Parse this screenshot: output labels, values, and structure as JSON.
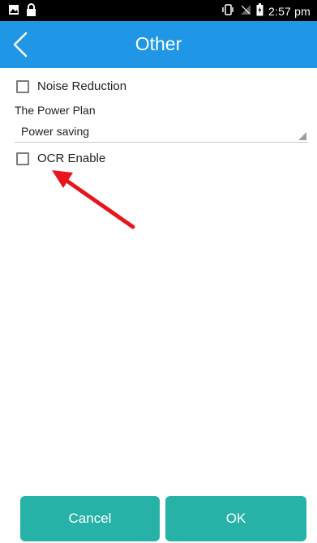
{
  "status_bar": {
    "time": "2:57 pm",
    "icons": [
      "image-icon",
      "lock-icon",
      "vibrate-icon",
      "no-signal-icon",
      "battery-icon"
    ]
  },
  "app_bar": {
    "title": "Other",
    "back_icon": "chevron-left-icon",
    "color": "#1f96e6"
  },
  "settings": {
    "noise_reduction": {
      "label": "Noise Reduction",
      "checked": false
    },
    "power_plan": {
      "label": "The Power Plan",
      "value": "Power saving"
    },
    "ocr_enable": {
      "label": "OCR Enable",
      "checked": false
    }
  },
  "buttons": {
    "cancel": "Cancel",
    "ok": "OK",
    "color": "#26b2a6"
  },
  "annotation": {
    "color": "#e8141e",
    "icon": "red-arrow-pointer"
  }
}
